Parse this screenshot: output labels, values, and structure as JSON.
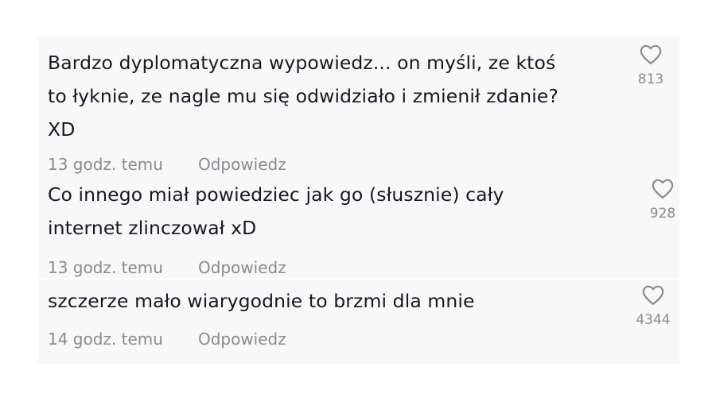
{
  "comments": [
    {
      "text_lines": [
        "Bardzo dyplomatyczna wypowiedz... on myśli, ze ktoś",
        "to łyknie, ze nagle mu się odwidziało i zmienił zdanie?",
        "XD"
      ],
      "time": "13 godz. temu",
      "reply_label": "Odpowiedz",
      "like_icon": "heart-outline-icon",
      "likes": "813"
    },
    {
      "text_lines": [
        "Co innego miał powiedziec jak go (słusznie) cały",
        "internet zlinczował xD"
      ],
      "time": "13 godz. temu",
      "reply_label": "Odpowiedz",
      "like_icon": "heart-outline-icon",
      "likes": "928"
    },
    {
      "text_lines": [
        "szczerze mało wiarygodnie to brzmi dla mnie"
      ],
      "time": "14 godz. temu",
      "reply_label": "Odpowiedz",
      "like_icon": "heart-outline-icon",
      "likes": "4344"
    }
  ],
  "colors": {
    "card_background": "#f8f8f8",
    "text": "#161823",
    "muted": "#8a8b91"
  }
}
